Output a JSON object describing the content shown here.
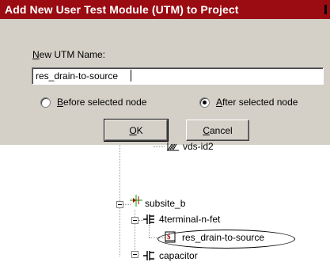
{
  "dialog": {
    "title": "Add New User Test Module (UTM) to Project",
    "name_label": {
      "hotkey": "N",
      "rest": "ew UTM Name:"
    },
    "name_value": "res_drain-to-source",
    "radio_before": {
      "hotkey": "B",
      "rest": "efore selected node",
      "checked": false
    },
    "radio_after": {
      "hotkey": "A",
      "rest": "fter selected node",
      "checked": true
    },
    "ok_button": {
      "hotkey": "O",
      "rest": "K"
    },
    "cancel_button": {
      "hotkey": "C",
      "rest": "ancel"
    }
  },
  "tree": {
    "items": [
      {
        "label": "vds-id2",
        "icon": "curve-chart-icon"
      },
      {
        "label": "subsite_b",
        "icon": "subsite-icon"
      },
      {
        "label": "4terminal-n-fet",
        "icon": "fet-icon"
      },
      {
        "label": "res_drain-to-source",
        "icon": "utm-module-icon"
      },
      {
        "label": "capacitor",
        "icon": "fet-icon"
      }
    ]
  },
  "colors": {
    "titlebar": "#9a0b12",
    "dialog_bg": "#d4d0c8"
  }
}
